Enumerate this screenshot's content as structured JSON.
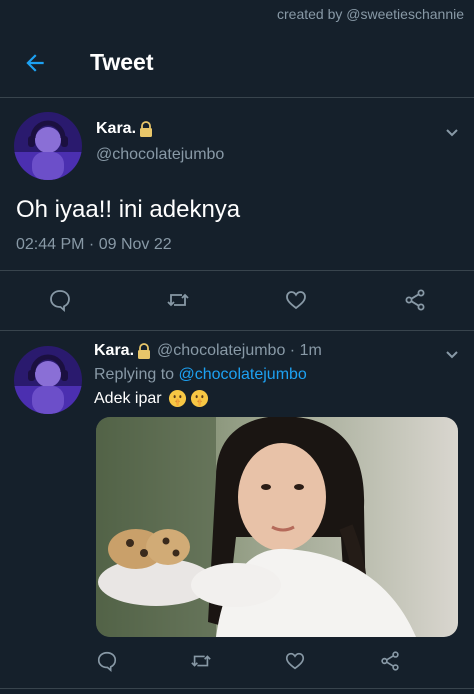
{
  "watermark": "created by @sweetieschannie",
  "header": {
    "title": "Tweet",
    "back_icon": "arrow-left-icon"
  },
  "colors": {
    "background": "#15202b",
    "accent": "#1da1f2",
    "muted": "#8899a6",
    "divider": "#38444d"
  },
  "main_tweet": {
    "display_name": "Kara.",
    "handle": "@chocolatejumbo",
    "text": "Oh iyaa!! ini adeknya",
    "timestamp": "02:44 PM · 09 Nov 22",
    "actions": [
      "reply-icon",
      "retweet-icon",
      "like-icon",
      "share-icon"
    ]
  },
  "reply": {
    "display_name": "Kara.",
    "handle_time": "@chocolatejumbo · 1m",
    "replying_prefix": "Replying to",
    "replying_handle": "@chocolatejumbo",
    "text": "Adek ipar",
    "emojis": [
      "shushing-face-emoji",
      "shushing-face-emoji"
    ],
    "media": "photo",
    "actions": [
      "reply-icon",
      "retweet-icon",
      "like-icon",
      "share-icon"
    ]
  }
}
